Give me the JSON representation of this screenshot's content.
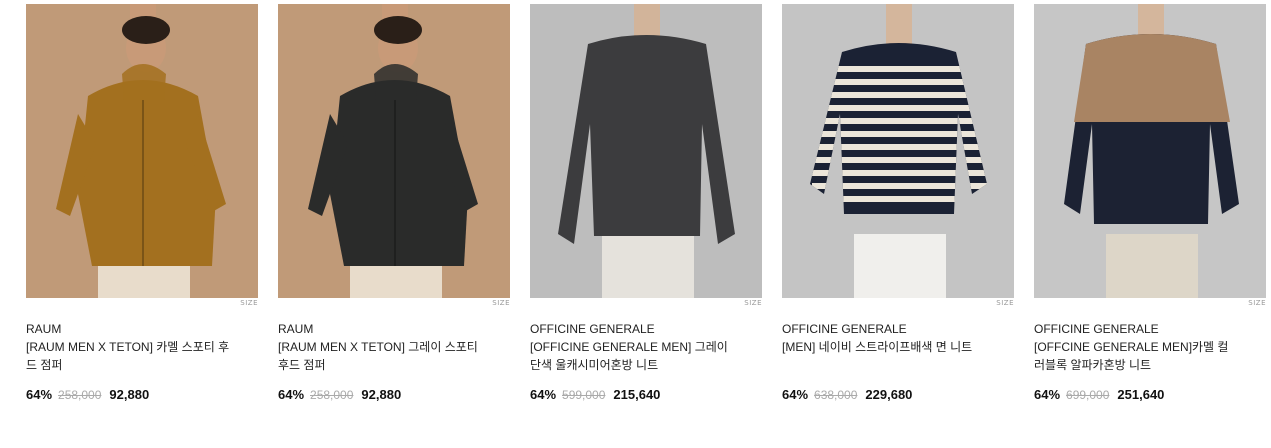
{
  "products": [
    {
      "brand": "RAUM",
      "name": "[RAUM MEN X TETON] 카멜 스포티 후드 점퍼",
      "discount": "64%",
      "original_price": "258,000",
      "sale_price": "92,880",
      "size_label": "SIZE",
      "image": {
        "background": "#c09a78",
        "garment": "#a3701f",
        "garment_type": "hooded-parka",
        "pants": "#e8dccb",
        "skin": "#c89a78",
        "hair": "#2a1f18"
      }
    },
    {
      "brand": "RAUM",
      "name": "[RAUM MEN X TETON] 그레이 스포티 후드 점퍼",
      "discount": "64%",
      "original_price": "258,000",
      "sale_price": "92,880",
      "size_label": "SIZE",
      "image": {
        "background": "#c09a78",
        "garment": "#2a2b2a",
        "garment_type": "hooded-parka",
        "pants": "#e8dccb",
        "skin": "#c89a78",
        "hair": "#2a1f18"
      }
    },
    {
      "brand": "OFFICINE GENERALE",
      "name": "[OFFICINE GENERALE MEN] 그레이 단색 울캐시미어혼방 니트",
      "discount": "64%",
      "original_price": "599,000",
      "sale_price": "215,640",
      "size_label": "SIZE",
      "image": {
        "background": "#bdbdbd",
        "garment": "#3c3c3e",
        "garment_type": "crewneck-knit",
        "pants": "#e5e2dc",
        "skin": "#d2b49a",
        "hair": "#3a2d22"
      }
    },
    {
      "brand": "OFFICINE GENERALE",
      "name": "[MEN] 네이비 스트라이프배색 면 니트",
      "discount": "64%",
      "original_price": "638,000",
      "sale_price": "229,680",
      "size_label": "SIZE",
      "image": {
        "background": "#c4c4c4",
        "garment": "#1b2234",
        "garment_type": "striped-knit",
        "stripe": "#ece6da",
        "pants": "#f0efec",
        "skin": "#d4b69c",
        "hair": "#3a2d22"
      }
    },
    {
      "brand": "OFFICINE GENERALE",
      "name": "[OFFCINE GENERALE MEN]카멜 컬러블록 알파카혼방 니트",
      "discount": "64%",
      "original_price": "699,000",
      "sale_price": "251,640",
      "size_label": "SIZE",
      "image": {
        "background": "#c6c6c6",
        "garment": "#1c2233",
        "garment_type": "colorblock-knit",
        "top_block": "#a98463",
        "pants": "#ddd6c8",
        "skin": "#d4b69c",
        "hair": "#3a2d22"
      }
    }
  ]
}
